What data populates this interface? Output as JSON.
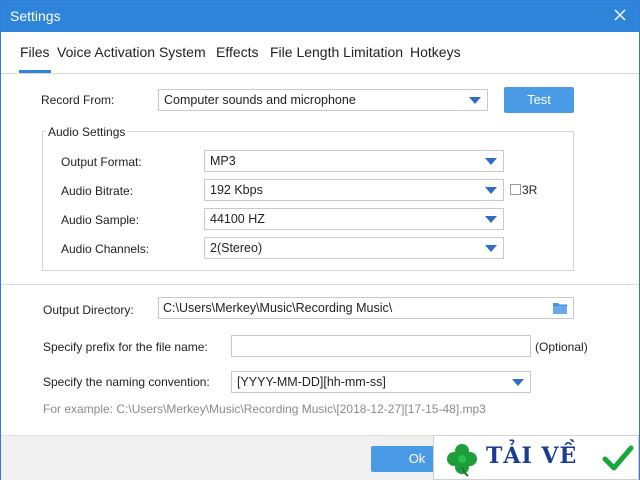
{
  "window": {
    "title": "Settings"
  },
  "tabs": [
    {
      "label": "Files",
      "active": true
    },
    {
      "label": "Voice Activation System"
    },
    {
      "label": "Effects"
    },
    {
      "label": "File Length Limitation"
    },
    {
      "label": "Hotkeys"
    }
  ],
  "record": {
    "label": "Record  From:",
    "value": "Computer sounds and microphone",
    "test_label": "Test"
  },
  "audio": {
    "group_title": "Audio Settings",
    "format_label": "Output Format:",
    "format_value": "MP3",
    "bitrate_label": "Audio Bitrate:",
    "bitrate_value": "192 Kbps",
    "vbr_label": "3R",
    "sample_label": "Audio Sample:",
    "sample_value": "44100 HZ",
    "channels_label": "Audio Channels:",
    "channels_value": "2(Stereo)"
  },
  "output": {
    "dir_label": "Output Directory:",
    "dir_value": "C:\\Users\\Merkey\\Music\\Recording Music\\",
    "prefix_label": "Specify prefix for the file name:",
    "prefix_value": "",
    "optional_label": "(Optional)",
    "naming_label": "Specify the naming convention:",
    "naming_value": "[YYYY-MM-DD][hh-mm-ss]",
    "example": "For example: C:\\Users\\Merkey\\Music\\Recording Music\\[2018-12-27][17-15-48].mp3"
  },
  "footer": {
    "ok_label": "Ok"
  },
  "watermark": {
    "text": "TẢI VỀ"
  },
  "colors": {
    "accent": "#2d84d8",
    "button": "#4a9be6",
    "caret": "#2d6dc4"
  },
  "icons": {
    "close": "close-icon",
    "dropdown": "chevron-down-icon",
    "folder": "folder-icon"
  }
}
